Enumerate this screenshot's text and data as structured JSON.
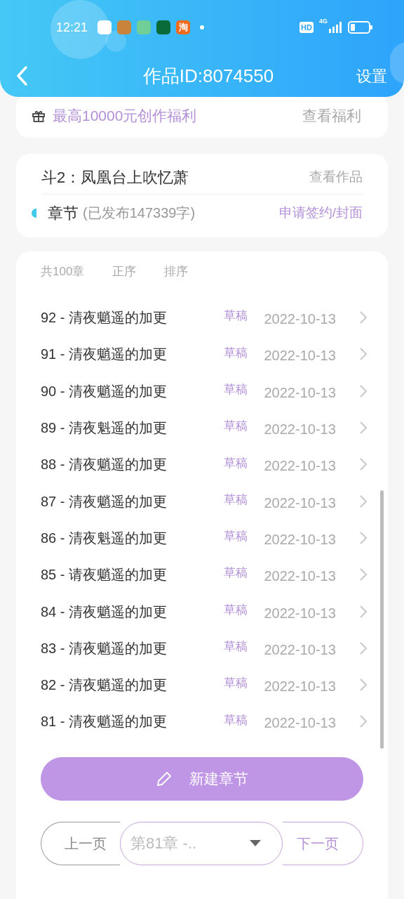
{
  "status_bar": {
    "time": "12:21",
    "notification_icons": [
      {
        "color": "#ffffff"
      },
      {
        "color": "#c8843a"
      },
      {
        "color": "#6fcf97"
      },
      {
        "color": "#0a6b3a"
      },
      {
        "color": "#f26a1b",
        "glyph": "淘"
      }
    ],
    "network": "4G",
    "hd": "HD"
  },
  "header": {
    "title": "作品ID:8074550",
    "action": "设置"
  },
  "promo": {
    "text": "最高10000元创作福利",
    "link": "查看福利"
  },
  "work": {
    "title": "斗2：凤凰台上吹忆萧",
    "link": "查看作品",
    "section": "章节",
    "published": "(已发布147339字)",
    "action": "申请签约/封面"
  },
  "chapters": {
    "count": "共100章",
    "sort_options": [
      {
        "label": "正序",
        "selected": false
      },
      {
        "label": "排序",
        "selected": false
      }
    ],
    "items": [
      {
        "title": "92 - 清夜魈遥的加更",
        "status": "草稿",
        "date": "2022-10-13"
      },
      {
        "title": "91 - 清夜魈遥的加更",
        "status": "草稿",
        "date": "2022-10-13"
      },
      {
        "title": "90 - 清夜魈遥的加更",
        "status": "草稿",
        "date": "2022-10-13"
      },
      {
        "title": "89 - 清夜魁遥的加更",
        "status": "草稿",
        "date": "2022-10-13"
      },
      {
        "title": "88 - 清夜魈遥的加更",
        "status": "草稿",
        "date": "2022-10-13"
      },
      {
        "title": "87 - 清夜魈遥的加更",
        "status": "草稿",
        "date": "2022-10-13"
      },
      {
        "title": "86 - 清夜魁遥的加更",
        "status": "草稿",
        "date": "2022-10-13"
      },
      {
        "title": "85 - 请夜魈遥的加更",
        "status": "草稿",
        "date": "2022-10-13"
      },
      {
        "title": "84 - 清夜魈遥的加更",
        "status": "草稿",
        "date": "2022-10-13"
      },
      {
        "title": "83 - 清夜魈遥的加更",
        "status": "草稿",
        "date": "2022-10-13"
      },
      {
        "title": "82 - 清夜魈遥的加更",
        "status": "草稿",
        "date": "2022-10-13"
      },
      {
        "title": "81 - 清夜魈遥的加更",
        "status": "草稿",
        "date": "2022-10-13"
      }
    ],
    "new_button": "新建章节"
  },
  "pager": {
    "prev": "上一页",
    "select": "第81章 -..",
    "next": "下一页"
  }
}
